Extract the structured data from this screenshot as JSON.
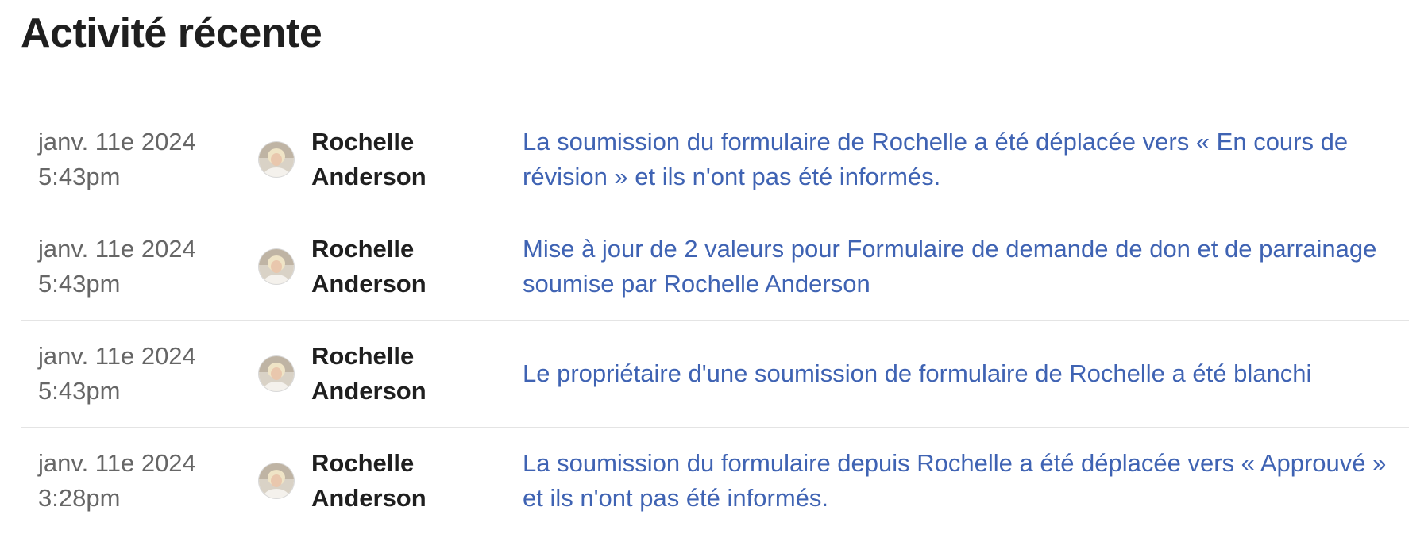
{
  "page": {
    "title": "Activité récente"
  },
  "colors": {
    "link": "#3f63b3",
    "date_text": "#666666",
    "divider": "#e4e4e4"
  },
  "activities": [
    {
      "date": "janv. 11e 2024",
      "time": "5:43pm",
      "user_first": "Rochelle",
      "user_last": "Anderson",
      "avatar_icon": "user-avatar-photo",
      "message": "La soumission du formulaire de Rochelle a été déplacée vers « En cours de révision » et ils n'ont pas été informés."
    },
    {
      "date": "janv. 11e 2024",
      "time": "5:43pm",
      "user_first": "Rochelle",
      "user_last": "Anderson",
      "avatar_icon": "user-avatar-photo",
      "message": "Mise à jour de 2 valeurs pour Formulaire de demande de don et de parrainage soumise par Rochelle Anderson"
    },
    {
      "date": "janv. 11e 2024",
      "time": "5:43pm",
      "user_first": "Rochelle",
      "user_last": "Anderson",
      "avatar_icon": "user-avatar-photo",
      "message": "Le propriétaire d'une soumission de formulaire de Rochelle a été blanchi"
    },
    {
      "date": "janv. 11e 2024",
      "time": "3:28pm",
      "user_first": "Rochelle",
      "user_last": "Anderson",
      "avatar_icon": "user-avatar-photo",
      "message": "La soumission du formulaire depuis Rochelle a été déplacée vers « Approuvé » et ils n'ont pas été informés."
    }
  ]
}
